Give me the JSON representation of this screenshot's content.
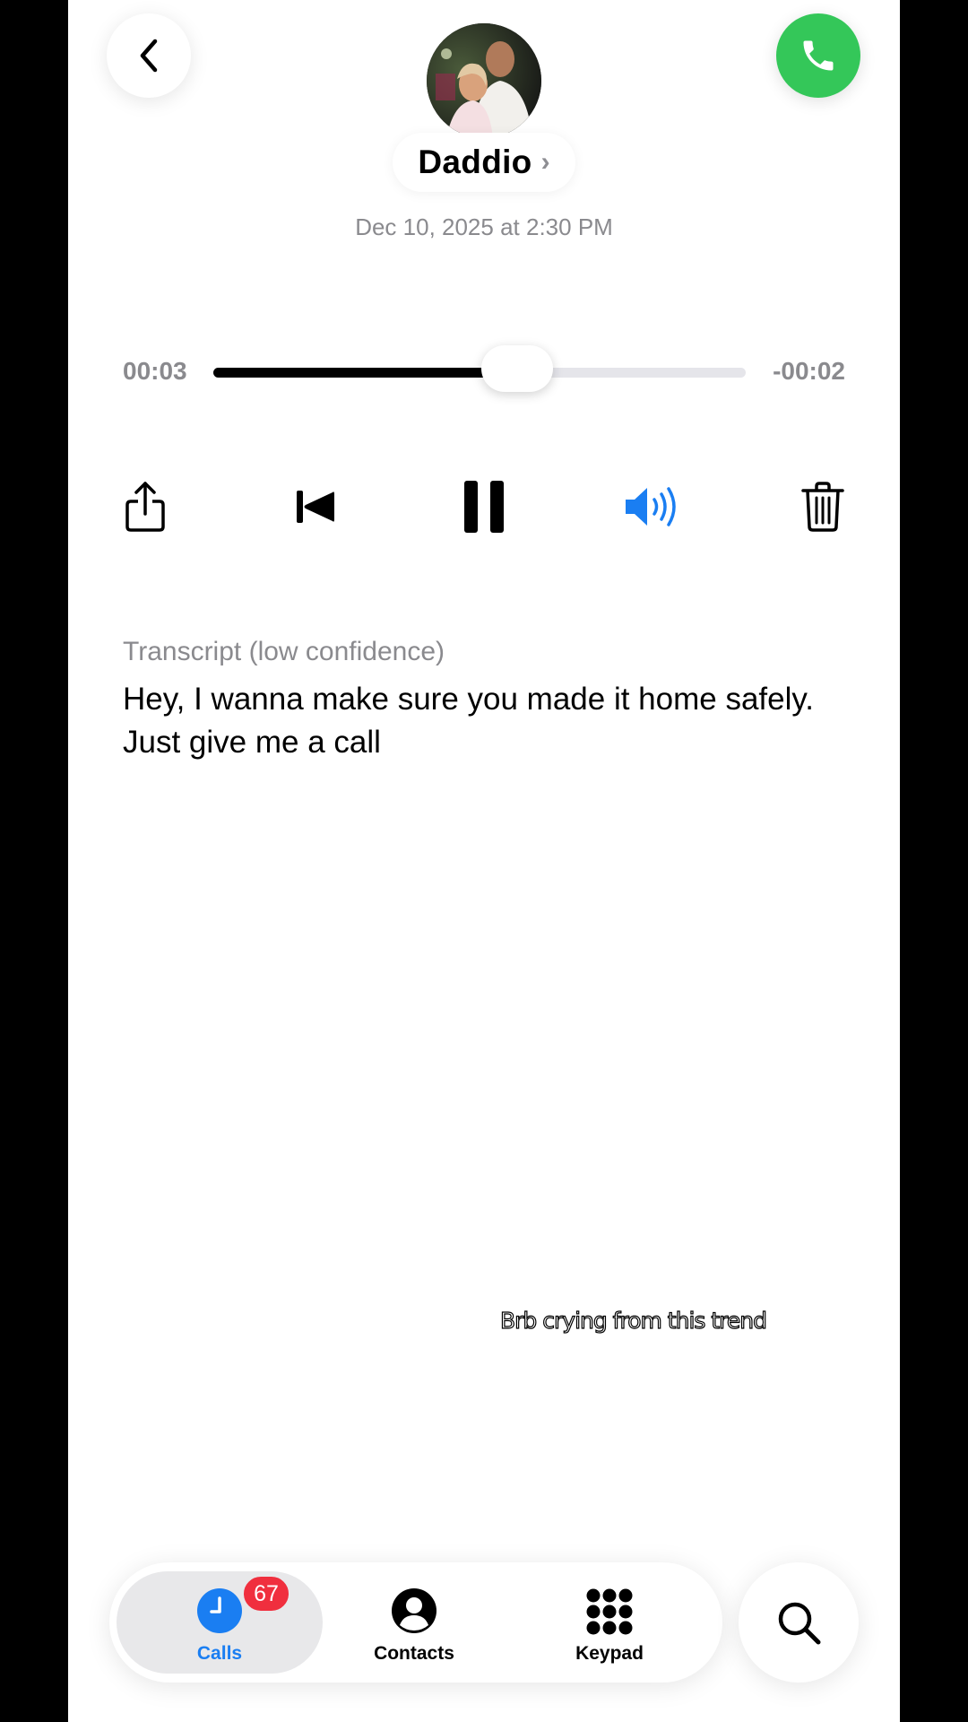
{
  "contact": {
    "name": "Daddio",
    "chevron": "›"
  },
  "voicemail": {
    "date": "Dec 10, 2025 at 2:30 PM",
    "elapsed": "00:03",
    "remaining": "-00:02",
    "progress": 0.57
  },
  "controls": {
    "share_icon": "share-icon",
    "rewind_icon": "skip-back-icon",
    "pause_icon": "pause-icon",
    "speaker_icon": "speaker-icon",
    "delete_icon": "trash-icon",
    "speaker_color": "#1a7ef2"
  },
  "transcript": {
    "label": "Transcript (low confidence)",
    "text": "Hey, I wanna make sure you made it home safely. Just give me a call"
  },
  "overlay": {
    "caption": "Brb crying from this trend"
  },
  "tabs": [
    {
      "label": "Calls",
      "badge": "67",
      "active": true
    },
    {
      "label": "Contacts",
      "active": false
    },
    {
      "label": "Keypad",
      "active": false
    }
  ],
  "colors": {
    "accent": "#1a7ef2",
    "call_green": "#34c759",
    "badge_red": "#f02f3e"
  }
}
